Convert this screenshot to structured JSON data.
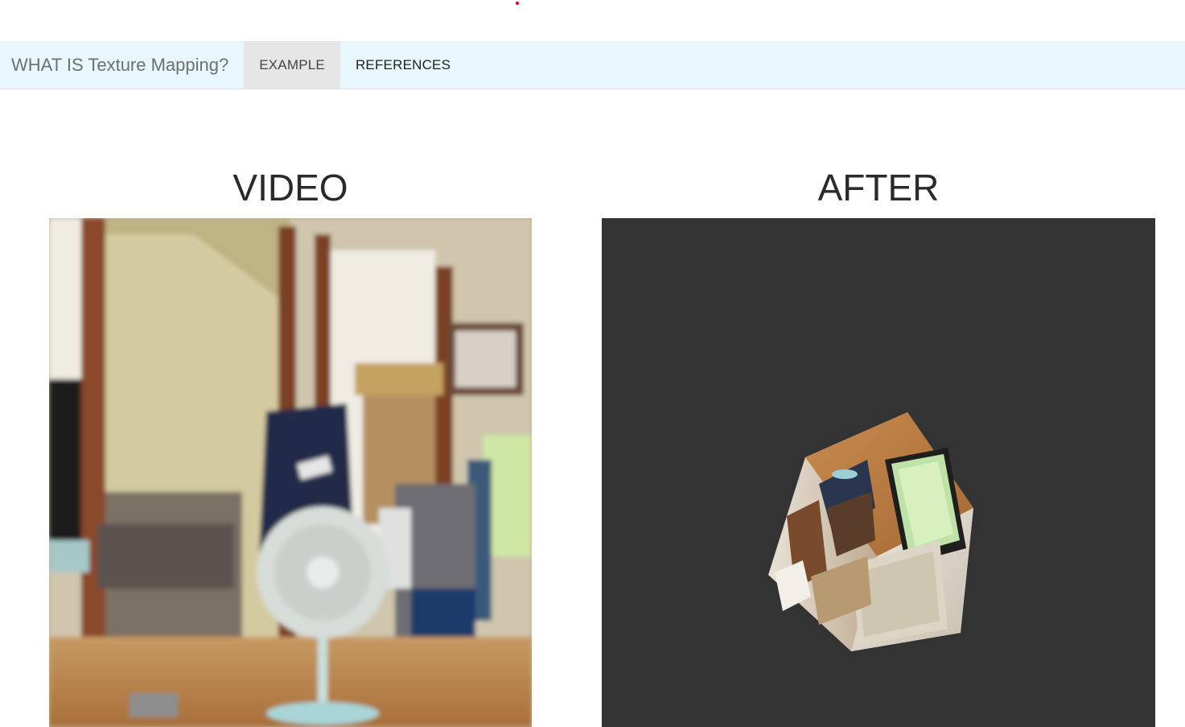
{
  "nav": {
    "brand": "WHAT IS Texture Mapping?",
    "links": [
      {
        "label": "EXAMPLE",
        "active": true
      },
      {
        "label": "REFERENCES",
        "active": false
      }
    ]
  },
  "sections": {
    "video_title": "VIDEO",
    "after_title": "AFTER"
  },
  "colors": {
    "navbar_bg": "#e8f7fd",
    "active_tab_bg": "#e6e6e6",
    "canvas_bg": "#333333"
  }
}
